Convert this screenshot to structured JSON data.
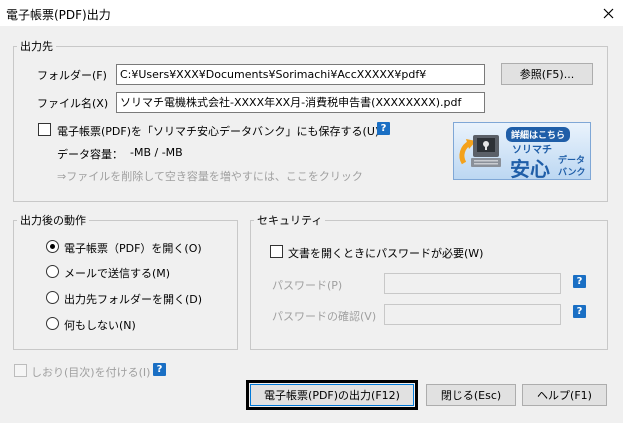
{
  "window": {
    "title": "電子帳票(PDF)出力"
  },
  "output_dest": {
    "legend": "出力先",
    "folder_label": "フォルダー(F)",
    "folder_value": "C:¥Users¥XXX¥Documents¥Sorimachi¥AccXXXXX¥pdf¥",
    "browse_label": "参照(F5)...",
    "filename_label": "ファイル名(X)",
    "filename_value": "ソリマチ電機株式会社-XXXX年XX月-消費税申告書(XXXXXXXX).pdf",
    "save_checkbox_label": "電子帳票(PDF)を「ソリマチ安心データバンク」にも保存する(U)",
    "capacity_label": "データ容量：",
    "capacity_value": "-MB / -MB",
    "hint_text": "⇒ファイルを削除して空き容量を増やすには、ここをクリック"
  },
  "banner": {
    "tag": "詳細はこちら",
    "sub": "ソリマチ",
    "main": "安心",
    "side1": "データ",
    "side2": "バンク"
  },
  "after_output": {
    "legend": "出力後の動作",
    "options": [
      {
        "label": "電子帳票（PDF）を開く(O)",
        "selected": true
      },
      {
        "label": "メールで送信する(M)",
        "selected": false
      },
      {
        "label": "出力先フォルダーを開く(D)",
        "selected": false
      },
      {
        "label": "何もしない(N)",
        "selected": false
      }
    ]
  },
  "security": {
    "legend": "セキュリティ",
    "password_required_label": "文書を開くときにパスワードが必要(W)",
    "password_label": "パスワード(P)",
    "password_confirm_label": "パスワードの確認(V)"
  },
  "bookmark": {
    "label": "しおり(目次)を付ける(I)"
  },
  "buttons": {
    "output": "電子帳票(PDF)の出力(F12)",
    "close": "閉じる(Esc)",
    "help": "ヘルプ(F1)"
  },
  "help_icon_glyph": "?",
  "colors": {
    "accent": "#0078d7",
    "help_icon": "#1a6fc4",
    "banner_blue": "#1f5ea8"
  }
}
